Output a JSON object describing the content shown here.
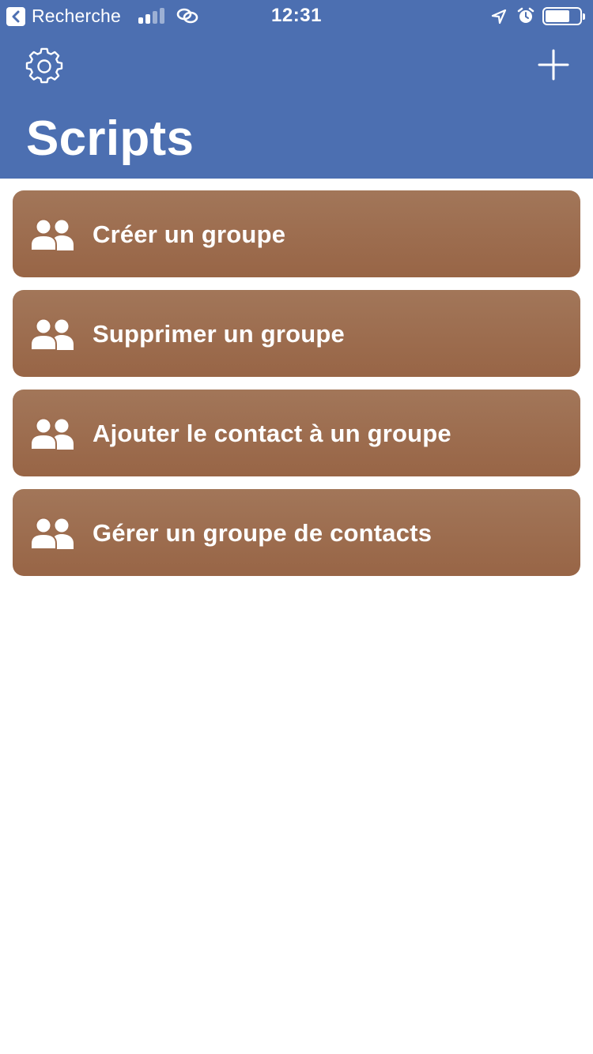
{
  "status_bar": {
    "back_label": "Recherche",
    "time": "12:31"
  },
  "header": {
    "title": "Scripts",
    "settings_icon": "gear-icon",
    "add_icon": "plus-icon"
  },
  "colors": {
    "header_bg": "#4c6fb1",
    "item_bg_top": "#a27659",
    "item_bg_bottom": "#986546"
  },
  "scripts": [
    {
      "label": "Créer un groupe",
      "icon": "group-icon"
    },
    {
      "label": "Supprimer un groupe",
      "icon": "group-icon"
    },
    {
      "label": "Ajouter le contact à un groupe",
      "icon": "group-icon"
    },
    {
      "label": "Gérer un groupe de contacts",
      "icon": "group-icon"
    }
  ]
}
